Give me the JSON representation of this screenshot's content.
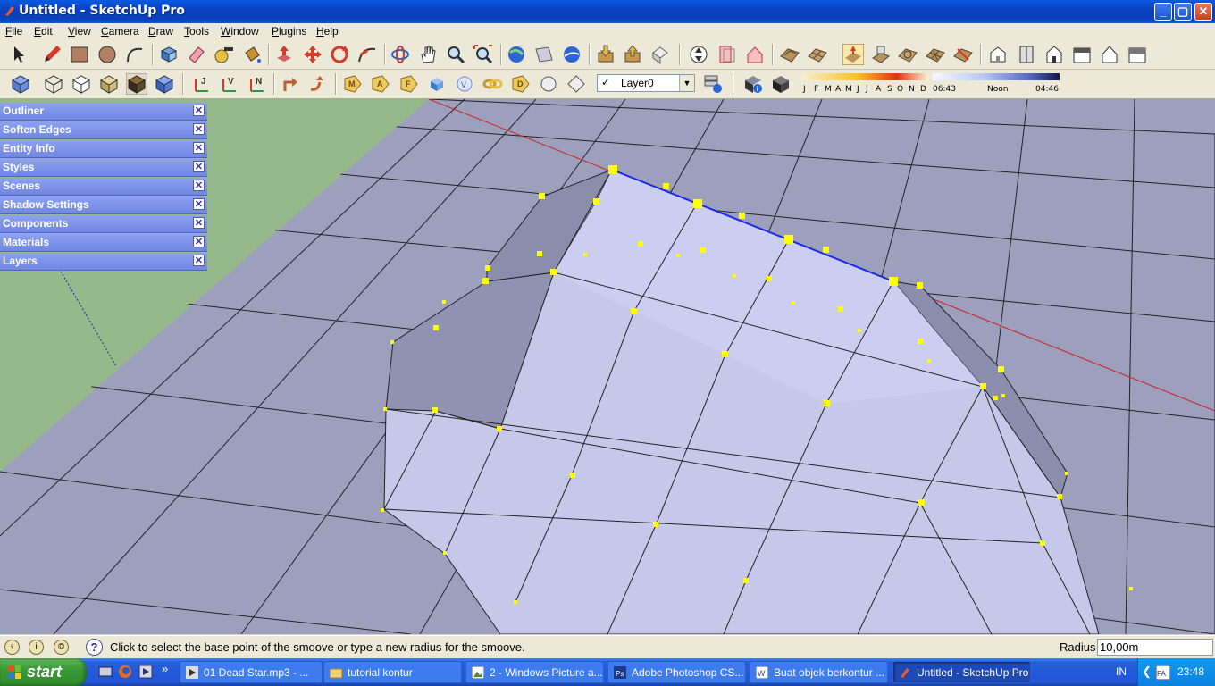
{
  "window": {
    "title": "Untitled - SketchUp Pro",
    "controls": {
      "minimize": "_",
      "maximize": "▢",
      "close": "✕"
    }
  },
  "menu": [
    "File",
    "Edit",
    "View",
    "Camera",
    "Draw",
    "Tools",
    "Window",
    "Plugins",
    "Help"
  ],
  "toolbar": {
    "layer_check": "✓",
    "layer_value": "Layer0",
    "shadow_months": [
      "J",
      "F",
      "M",
      "A",
      "M",
      "J",
      "J",
      "A",
      "S",
      "O",
      "N",
      "D"
    ],
    "shadow_time": {
      "start": "06:43",
      "noon": "Noon",
      "end": "04:46"
    }
  },
  "tray": [
    "Outliner",
    "Soften Edges",
    "Entity Info",
    "Styles",
    "Scenes",
    "Shadow Settings",
    "Components",
    "Materials",
    "Layers"
  ],
  "tray_close_glyph": "✕",
  "status": {
    "help_glyph": "?",
    "text": "Click to select the base point of the smoove or type a new radius for the smoove.",
    "radius_label": "Radius",
    "radius_value": "10,00m"
  },
  "taskbar": {
    "start_label": "start",
    "more_glyph": "»",
    "tasks": [
      "01 Dead Star.mp3 - ...",
      "tutorial kontur",
      "2 - Windows Picture a...",
      "Adobe Photoshop CS...",
      "Buat objek berkontur ...",
      "Untitled - SketchUp Pro"
    ],
    "language": "IN",
    "clock": "23:48"
  },
  "colors": {
    "titlebar": "#0a56d8",
    "ground": "#95b98a",
    "terrain_flat": "#9da0bd",
    "terrain_slope": "#c8cbe8",
    "selection": "#ffff00",
    "tray": "#7b90e8",
    "taskbar": "#245edb"
  },
  "icons": {
    "toolbar1": [
      "select-icon",
      "pencil-icon",
      "rectangle-icon",
      "circle-icon",
      "arc-icon",
      "make-component-icon",
      "eraser-icon",
      "tape-measure-icon",
      "paint-bucket-icon",
      "push-pull-icon",
      "move-icon",
      "rotate-icon",
      "follow-me-icon",
      "orbit-icon",
      "pan-icon",
      "zoom-icon",
      "zoom-extents-icon",
      "get-models-icon",
      "share-model-icon",
      "google-earth-icon",
      "import-icon",
      "export-icon",
      "components-icon",
      "section-plane-icon",
      "display-section-icon",
      "cut-icon",
      "sandbox-from-contours-icon",
      "sandbox-from-scratch-icon",
      "smoove-icon",
      "stamp-icon",
      "drape-icon",
      "add-detail-icon",
      "flip-edge-icon",
      "iso-view-icon",
      "top-view-icon",
      "front-view-icon",
      "right-view-icon",
      "back-view-icon",
      "left-view-icon"
    ],
    "toolbar2": [
      "xray-icon",
      "wireframe-icon",
      "hidden-line-icon",
      "shaded-icon",
      "shaded-textures-icon",
      "monochrome-icon",
      "axes-j-icon",
      "axes-v-icon",
      "axes-n-icon",
      "undo-icon",
      "redo-icon",
      "tag-m-icon",
      "tag-a-icon",
      "tag-f-icon",
      "cube-icon",
      "sphere-icon",
      "link-icon",
      "tag-d-icon",
      "circle-tool-icon",
      "polygon-icon",
      "layer-manager-icon",
      "entity-info-icon",
      "shadow-toggle-icon"
    ]
  }
}
